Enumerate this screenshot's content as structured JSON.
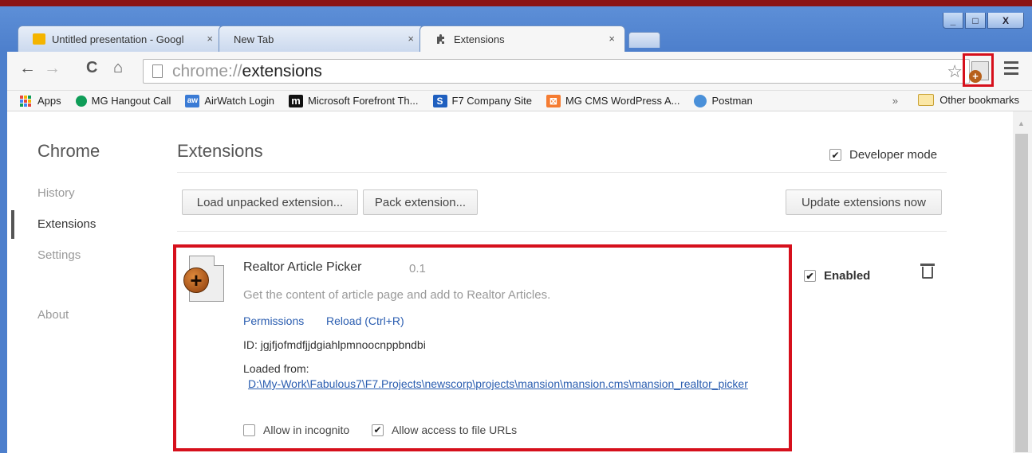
{
  "window": {
    "controls": {
      "minimize": "_",
      "maximize": "□",
      "close": "X"
    }
  },
  "tabs": [
    {
      "label": "Untitled presentation - Googl",
      "close": "×",
      "icon": "google-slides-icon",
      "color": "#f4b400",
      "active": false
    },
    {
      "label": "New Tab",
      "close": "×",
      "icon": "",
      "active": false
    },
    {
      "label": "Extensions",
      "close": "×",
      "icon": "puzzle-icon",
      "active": true
    }
  ],
  "toolbar": {
    "back": "←",
    "forward": "→",
    "reload": "C",
    "home": "⌂",
    "url_scheme": "chrome://",
    "url_path": "extensions",
    "star": "☆"
  },
  "bookmarks": {
    "items": [
      {
        "label": "Apps",
        "icon": "apps-grid-icon",
        "color": "#e8453c"
      },
      {
        "label": "MG Hangout Call",
        "icon": "hangouts-icon",
        "color": "#0f9d58"
      },
      {
        "label": "AirWatch Login",
        "icon": "airwatch-icon",
        "color": "#3a7bd5",
        "glyph": "aw"
      },
      {
        "label": "Microsoft Forefront Th...",
        "icon": "forefront-icon",
        "color": "#111111",
        "glyph": "m"
      },
      {
        "label": "F7 Company Site",
        "icon": "sharepoint-icon",
        "color": "#1f5fbf",
        "glyph": "S"
      },
      {
        "label": "MG CMS WordPress A...",
        "icon": "wordpress-icon",
        "color": "#f57c32",
        "glyph": "⊠"
      },
      {
        "label": "Postman",
        "icon": "postman-icon",
        "color": "#4a90d9",
        "glyph": "●"
      }
    ],
    "more": "»",
    "other": "Other bookmarks"
  },
  "sidebar": {
    "title": "Chrome",
    "items": [
      {
        "label": "History",
        "selected": false
      },
      {
        "label": "Extensions",
        "selected": true
      },
      {
        "label": "Settings",
        "selected": false
      },
      {
        "label": "About",
        "selected": false
      }
    ]
  },
  "main": {
    "title": "Extensions",
    "developer_mode_label": "Developer mode",
    "developer_mode_checked": true,
    "buttons": {
      "load_unpacked": "Load unpacked extension...",
      "pack": "Pack extension...",
      "update": "Update extensions now"
    }
  },
  "extension": {
    "name": "Realtor Article Picker",
    "version": "0.1",
    "description": "Get the content of article page and add to Realtor Articles.",
    "permissions_link": "Permissions",
    "reload_link": "Reload (Ctrl+R)",
    "id": "ID: jgjfjofmdfjjdgiahlpmnoocnppbndbi",
    "loaded_from_label": "Loaded from:",
    "path": "D:\\My-Work\\Fabulous7\\F7.Projects\\newscorp\\projects\\mansion\\mansion.cms\\mansion_realtor_picker",
    "allow_incognito": "Allow in incognito",
    "allow_incognito_checked": false,
    "allow_file_urls": "Allow access to file URLs",
    "allow_file_urls_checked": true,
    "enabled_label": "Enabled",
    "enabled_checked": true
  },
  "colors": {
    "highlight": "#d6101c",
    "link": "#2a5db0",
    "frame": "#4d7fcc"
  }
}
